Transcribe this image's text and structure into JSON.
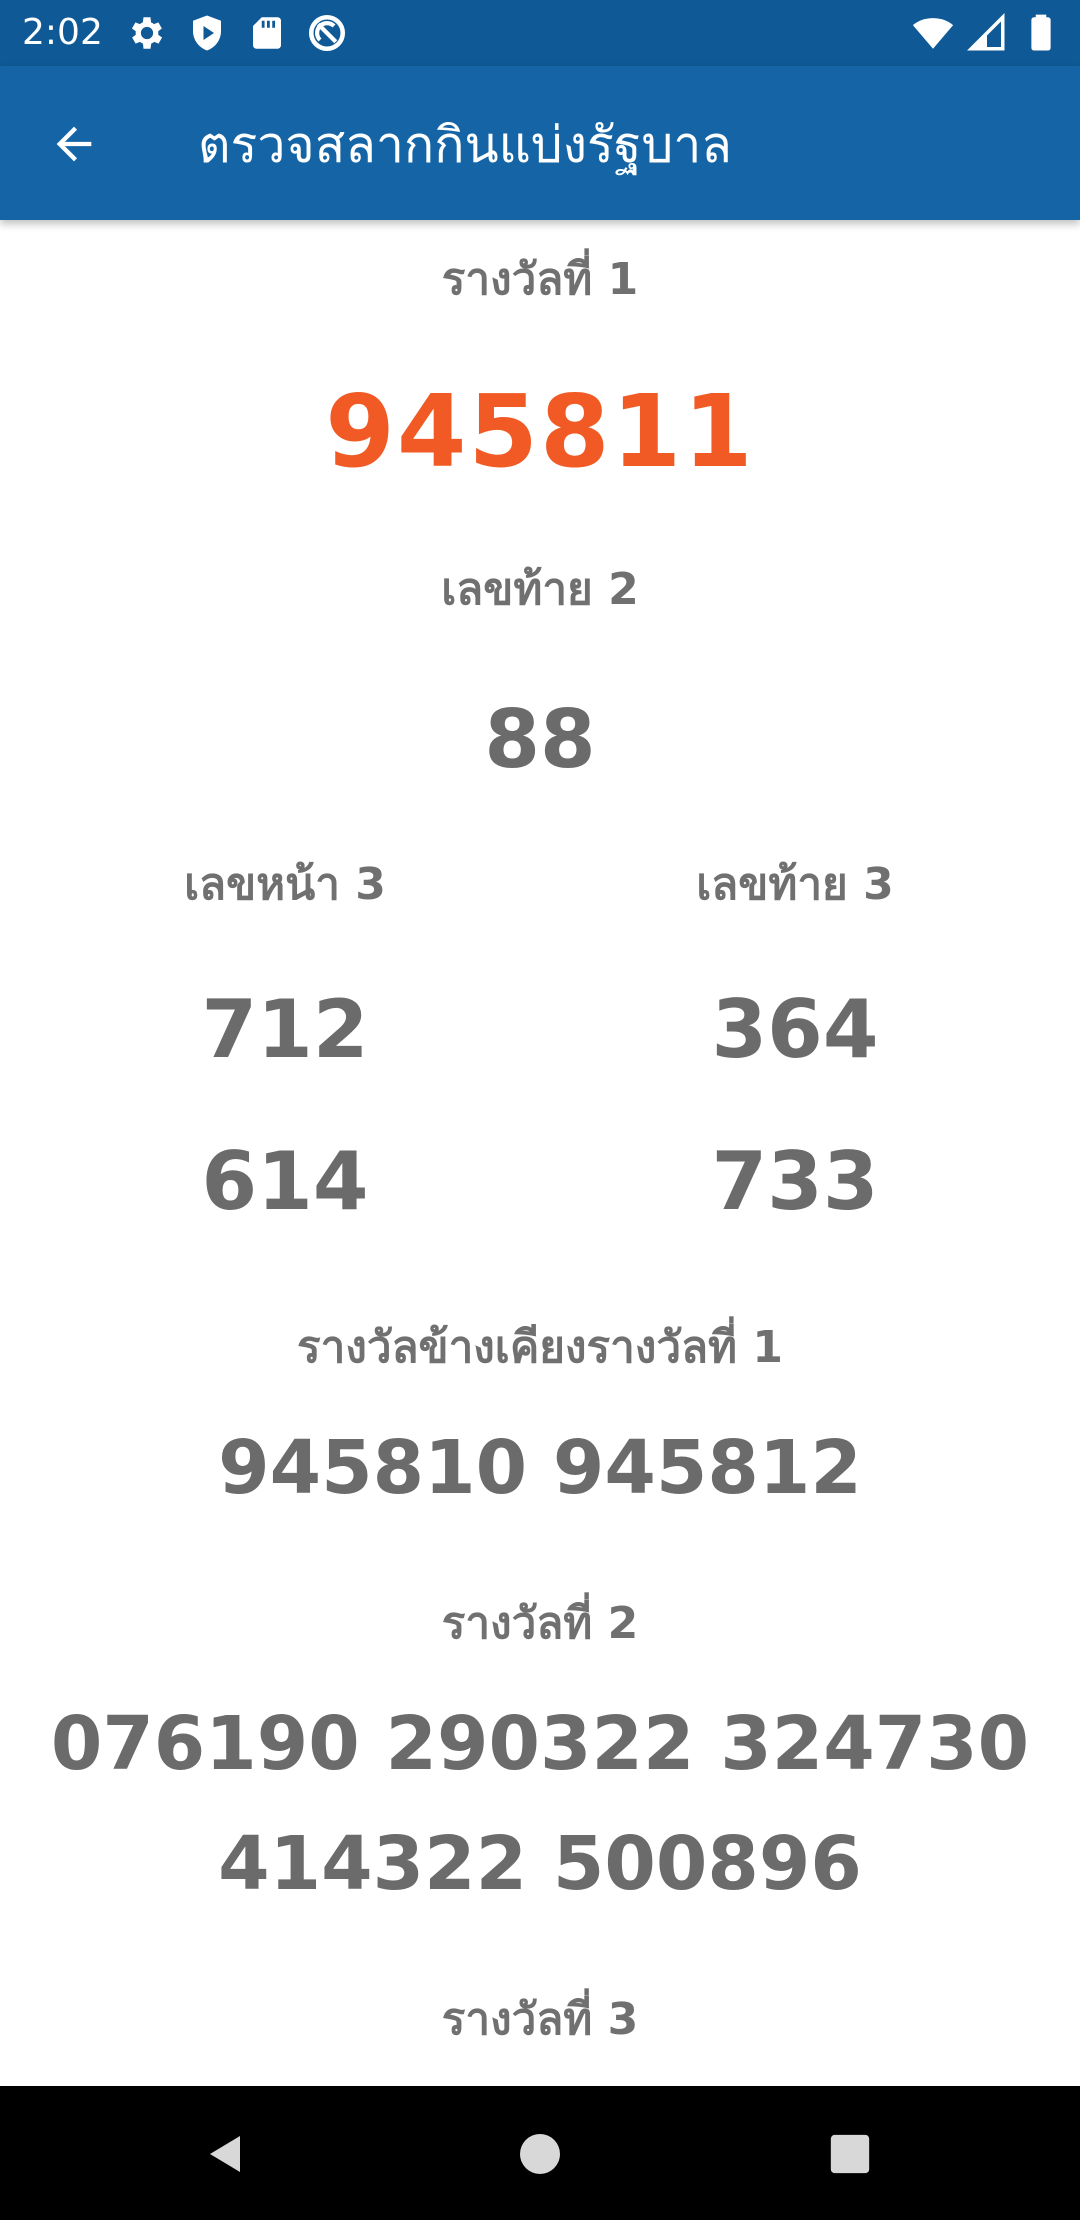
{
  "status_bar": {
    "time": "2:02",
    "left_icons": [
      "gear-icon",
      "shield-icon",
      "sd-card-icon",
      "no-signal-circle-icon"
    ],
    "right_icons": [
      "wifi-icon",
      "cell-signal-icon",
      "battery-icon"
    ]
  },
  "app_bar": {
    "title": "ตรวจสลากกินแบ่งรัฐบาล",
    "background": "#1565a6"
  },
  "results": {
    "first_prize": {
      "label": "รางวัลที่ 1",
      "number": "945811",
      "color": "#f15a24"
    },
    "last_two": {
      "label": "เลขท้าย 2",
      "number": "88"
    },
    "front_three": {
      "label": "เลขหน้า 3",
      "numbers": [
        "712",
        "614"
      ]
    },
    "last_three": {
      "label": "เลขท้าย 3",
      "numbers": [
        "364",
        "733"
      ]
    },
    "near_first": {
      "label": "รางวัลข้างเคียงรางวัลที่ 1",
      "numbers_line": "945810 945812"
    },
    "second_prize": {
      "label": "รางวัลที่ 2",
      "line1": "076190 290322 324730",
      "line2": "414322 500896"
    },
    "third_prize": {
      "label": "รางวัลที่ 3"
    }
  },
  "nav_bar": {
    "buttons": [
      "back-triangle-icon",
      "home-circle-icon",
      "recents-square-icon"
    ]
  }
}
